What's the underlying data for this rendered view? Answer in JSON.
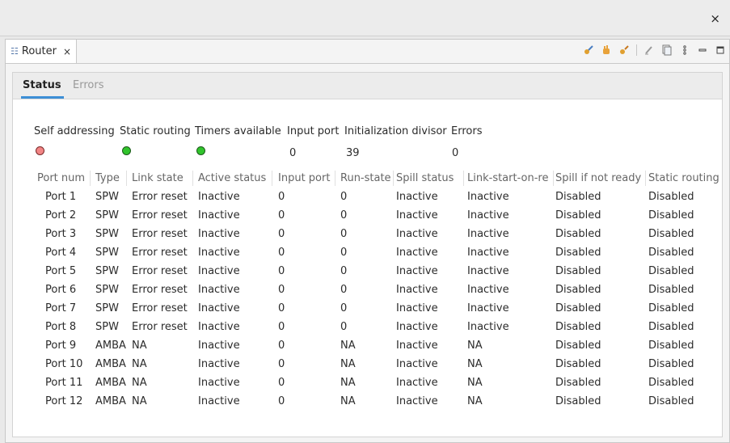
{
  "window": {
    "close_glyph": "×"
  },
  "view_tab": {
    "icon": "router-view-icon",
    "label": "Router",
    "close_glyph": "×"
  },
  "toolbar": {
    "icons": [
      "connect-icon",
      "hand-icon",
      "disconnect-icon",
      "clear-icon",
      "copy-icon",
      "more-vertical-icon",
      "minimize-icon",
      "maximize-icon"
    ]
  },
  "subtabs": {
    "status": "Status",
    "errors": "Errors"
  },
  "status": {
    "labels": [
      "Self addressing",
      "Static routing",
      "Timers available",
      "Input port",
      "Initialization divisor",
      "Errors"
    ],
    "self_addressing": "red",
    "static_routing": "green",
    "timers_available": "green",
    "input_port": "0",
    "initialization_divisor": "39",
    "errors": "0"
  },
  "table": {
    "headers": [
      "Port num",
      "Type",
      "Link state",
      "Active status",
      "Input port",
      "Run-state",
      "Spill status",
      "Link-start-on-re",
      "Spill if not ready",
      "Static routing"
    ],
    "rows": [
      [
        "Port 1",
        "SPW",
        "Error reset",
        "Inactive",
        "0",
        "0",
        "Inactive",
        "Inactive",
        "Disabled",
        "Disabled"
      ],
      [
        "Port 2",
        "SPW",
        "Error reset",
        "Inactive",
        "0",
        "0",
        "Inactive",
        "Inactive",
        "Disabled",
        "Disabled"
      ],
      [
        "Port 3",
        "SPW",
        "Error reset",
        "Inactive",
        "0",
        "0",
        "Inactive",
        "Inactive",
        "Disabled",
        "Disabled"
      ],
      [
        "Port 4",
        "SPW",
        "Error reset",
        "Inactive",
        "0",
        "0",
        "Inactive",
        "Inactive",
        "Disabled",
        "Disabled"
      ],
      [
        "Port 5",
        "SPW",
        "Error reset",
        "Inactive",
        "0",
        "0",
        "Inactive",
        "Inactive",
        "Disabled",
        "Disabled"
      ],
      [
        "Port 6",
        "SPW",
        "Error reset",
        "Inactive",
        "0",
        "0",
        "Inactive",
        "Inactive",
        "Disabled",
        "Disabled"
      ],
      [
        "Port 7",
        "SPW",
        "Error reset",
        "Inactive",
        "0",
        "0",
        "Inactive",
        "Inactive",
        "Disabled",
        "Disabled"
      ],
      [
        "Port 8",
        "SPW",
        "Error reset",
        "Inactive",
        "0",
        "0",
        "Inactive",
        "Inactive",
        "Disabled",
        "Disabled"
      ],
      [
        "Port 9",
        "AMBA",
        "NA",
        "Inactive",
        "0",
        "NA",
        "Inactive",
        "NA",
        "Disabled",
        "Disabled"
      ],
      [
        "Port 10",
        "AMBA",
        "NA",
        "Inactive",
        "0",
        "NA",
        "Inactive",
        "NA",
        "Disabled",
        "Disabled"
      ],
      [
        "Port 11",
        "AMBA",
        "NA",
        "Inactive",
        "0",
        "NA",
        "Inactive",
        "NA",
        "Disabled",
        "Disabled"
      ],
      [
        "Port 12",
        "AMBA",
        "NA",
        "Inactive",
        "0",
        "NA",
        "Inactive",
        "NA",
        "Disabled",
        "Disabled"
      ]
    ]
  },
  "colors": {
    "accent": "#3d8fd6",
    "led_red": "#f28585",
    "led_green": "#31c42c"
  }
}
